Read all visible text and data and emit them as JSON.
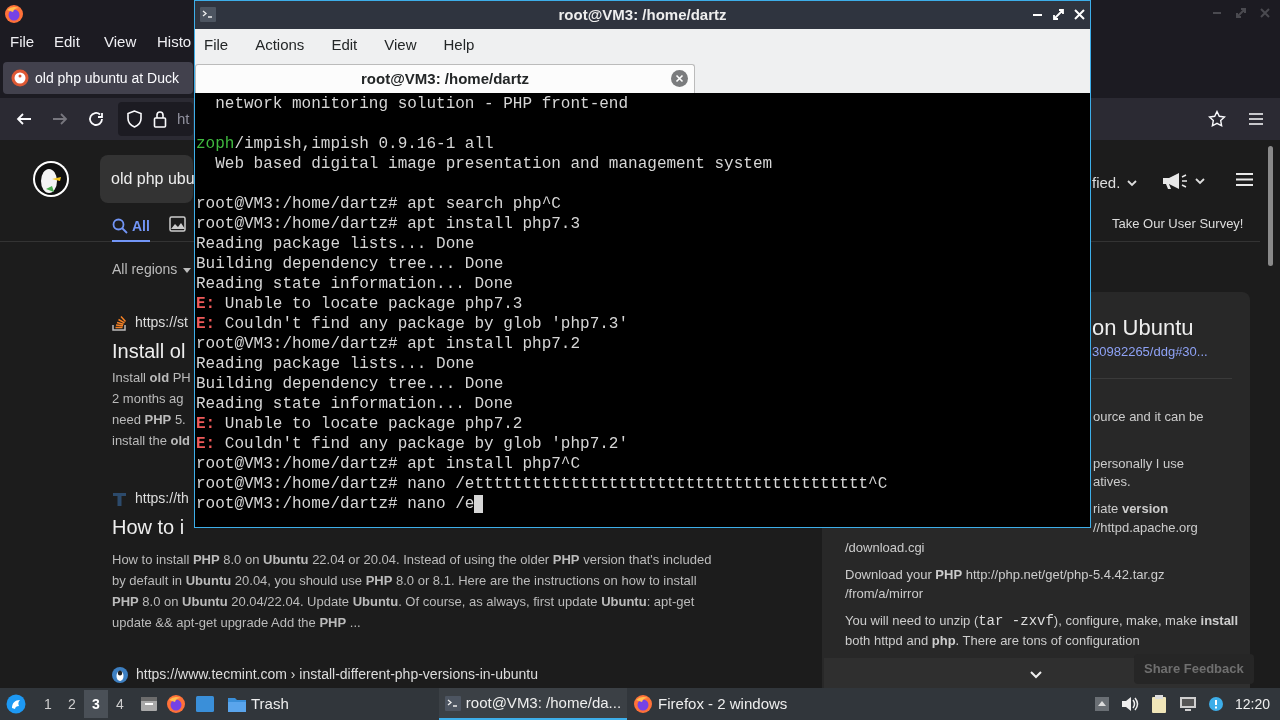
{
  "browser": {
    "menu": [
      "File",
      "Edit",
      "View",
      "Histo"
    ],
    "tab": {
      "title": "old php ubuntu at Duck"
    },
    "address": "ht",
    "search_query": "old php ubu",
    "safe_search": "fied.",
    "search_tabs": [
      {
        "label": "All",
        "selected": true
      }
    ],
    "survey": "Take Our User Survey!",
    "region": "All regions",
    "results": [
      {
        "url": "https://st",
        "title": "Install ol",
        "snippet_lines": [
          "Install **old** PH",
          "2 months ag",
          "need **PHP** 5.",
          "install the **old**"
        ]
      },
      {
        "url": "https://th",
        "title": "How to i",
        "snippet": "How to install **PHP** 8.0 on **Ubuntu** 22.04 or 20.04. Instead of using the older **PHP** version that's included by default in **Ubuntu** 20.04, you should use **PHP** 8.0 or 8.1. Here are the instructions on how to install **PHP** 8.0 on **Ubuntu** 20.04/22.04. Update **Ubuntu**. Of course, as always, first update **Ubuntu**: apt-get update && apt-get upgrade Add the **PHP** ..."
      },
      {
        "url": "https://www.tecmint.com › install-different-php-versions-in-ubuntu"
      }
    ],
    "panel": {
      "title": "on Ubuntu",
      "link": "30982265/ddg#30...",
      "fragments": [
        "ource and it can be",
        "personally I use",
        "atives.",
        "riate **version**",
        "//httpd.apache.org"
      ],
      "download_path": "/download.cgi",
      "download": "Download your **PHP** http://php.net/get/php-5.4.42.tar.gz /from/a/mirror",
      "unzip": {
        "before": "You will need to unzip (",
        "code": "tar -zxvf",
        "after": "), configure, make, make **install** both httpd and **php**. There are tons of configuration"
      }
    },
    "feedback": "Share Feedback"
  },
  "terminal": {
    "title": "root@VM3: /home/dartz",
    "menu": [
      "File",
      "Actions",
      "Edit",
      "View",
      "Help"
    ],
    "tab": "root@VM3: /home/dartz",
    "cursor": true,
    "lines": [
      {
        "kind": "output",
        "text": "  network monitoring solution - PHP front-end"
      },
      {
        "kind": "blank"
      },
      {
        "kind": "package",
        "name": "zoph",
        "text": "/impish,impish 0.9.16-1 all"
      },
      {
        "kind": "output",
        "text": "  Web based digital image presentation and management system"
      },
      {
        "kind": "blank"
      },
      {
        "kind": "output",
        "text": "root@VM3:/home/dartz# apt search php^C"
      },
      {
        "kind": "output",
        "text": "root@VM3:/home/dartz# apt install php7.3"
      },
      {
        "kind": "output",
        "text": "Reading package lists... Done"
      },
      {
        "kind": "output",
        "text": "Building dependency tree... Done"
      },
      {
        "kind": "output",
        "text": "Reading state information... Done"
      },
      {
        "kind": "error",
        "tag": "E:",
        "text": " Unable to locate package php7.3"
      },
      {
        "kind": "error",
        "tag": "E:",
        "text": " Couldn't find any package by glob 'php7.3'"
      },
      {
        "kind": "output",
        "text": "root@VM3:/home/dartz# apt install php7.2"
      },
      {
        "kind": "output",
        "text": "Reading package lists... Done"
      },
      {
        "kind": "output",
        "text": "Building dependency tree... Done"
      },
      {
        "kind": "output",
        "text": "Reading state information... Done"
      },
      {
        "kind": "error",
        "tag": "E:",
        "text": " Unable to locate package php7.2"
      },
      {
        "kind": "error",
        "tag": "E:",
        "text": " Couldn't find any package by glob 'php7.2'"
      },
      {
        "kind": "output",
        "text": "root@VM3:/home/dartz# apt install php7^C"
      },
      {
        "kind": "output",
        "text": "root@VM3:/home/dartz# nano /ettttttttttttttttttttttttttttttttttttttttt^C"
      },
      {
        "kind": "output",
        "text": "root@VM3:/home/dartz# nano /e"
      }
    ]
  },
  "taskbar": {
    "workspaces": [
      {
        "label": "1",
        "selected": false
      },
      {
        "label": "2",
        "selected": false
      },
      {
        "label": "3",
        "selected": true
      },
      {
        "label": "4",
        "selected": false
      }
    ],
    "trash": "Trash",
    "tasks": [
      {
        "kind": "terminal",
        "label": "root@VM3: /home/da...",
        "selected": true
      },
      {
        "kind": "firefox",
        "label": "Firefox - 2 windows",
        "selected": false
      }
    ],
    "clock": "12:20"
  }
}
